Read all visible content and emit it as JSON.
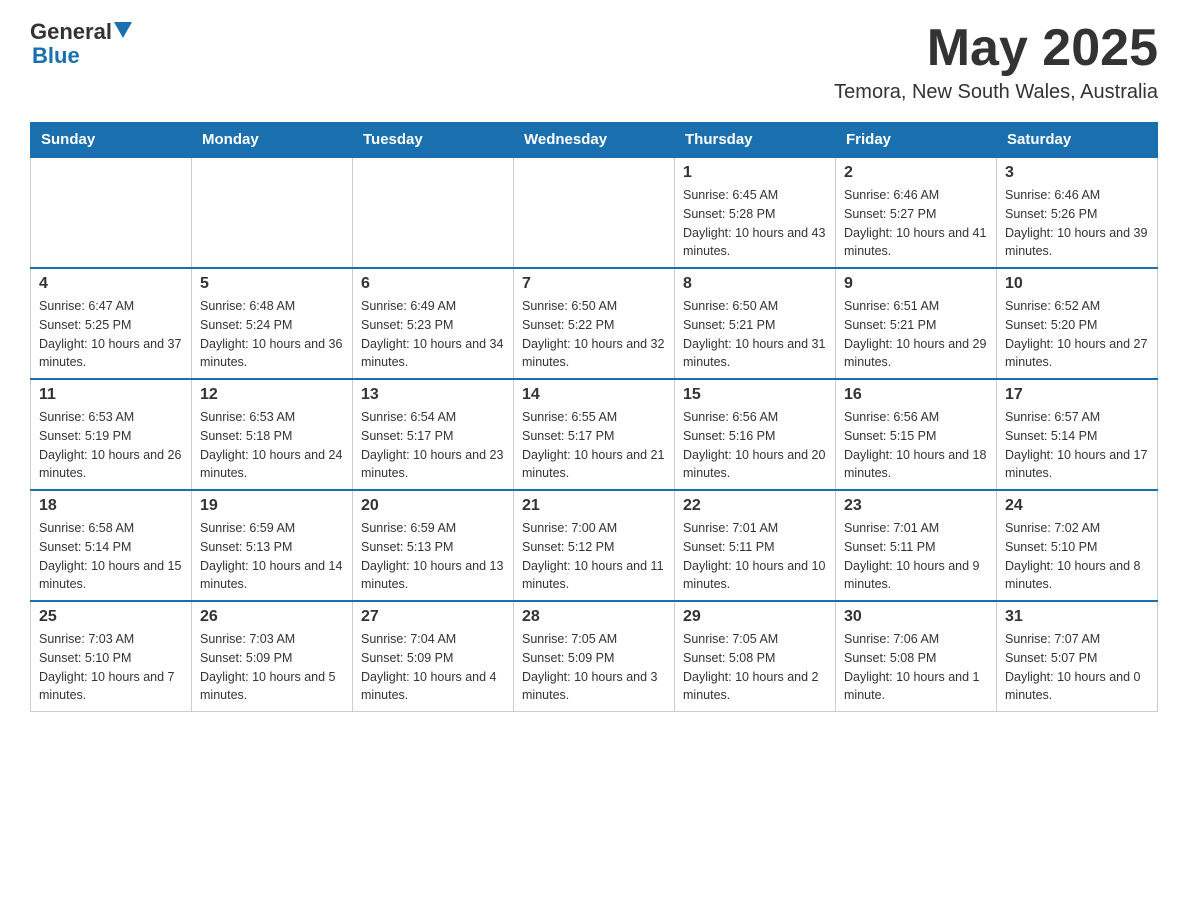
{
  "header": {
    "logo_general": "General",
    "logo_blue": "Blue",
    "month_title": "May 2025",
    "location": "Temora, New South Wales, Australia"
  },
  "days_of_week": [
    "Sunday",
    "Monday",
    "Tuesday",
    "Wednesday",
    "Thursday",
    "Friday",
    "Saturday"
  ],
  "weeks": [
    {
      "days": [
        {
          "num": "",
          "info": ""
        },
        {
          "num": "",
          "info": ""
        },
        {
          "num": "",
          "info": ""
        },
        {
          "num": "",
          "info": ""
        },
        {
          "num": "1",
          "info": "Sunrise: 6:45 AM\nSunset: 5:28 PM\nDaylight: 10 hours and 43 minutes."
        },
        {
          "num": "2",
          "info": "Sunrise: 6:46 AM\nSunset: 5:27 PM\nDaylight: 10 hours and 41 minutes."
        },
        {
          "num": "3",
          "info": "Sunrise: 6:46 AM\nSunset: 5:26 PM\nDaylight: 10 hours and 39 minutes."
        }
      ]
    },
    {
      "days": [
        {
          "num": "4",
          "info": "Sunrise: 6:47 AM\nSunset: 5:25 PM\nDaylight: 10 hours and 37 minutes."
        },
        {
          "num": "5",
          "info": "Sunrise: 6:48 AM\nSunset: 5:24 PM\nDaylight: 10 hours and 36 minutes."
        },
        {
          "num": "6",
          "info": "Sunrise: 6:49 AM\nSunset: 5:23 PM\nDaylight: 10 hours and 34 minutes."
        },
        {
          "num": "7",
          "info": "Sunrise: 6:50 AM\nSunset: 5:22 PM\nDaylight: 10 hours and 32 minutes."
        },
        {
          "num": "8",
          "info": "Sunrise: 6:50 AM\nSunset: 5:21 PM\nDaylight: 10 hours and 31 minutes."
        },
        {
          "num": "9",
          "info": "Sunrise: 6:51 AM\nSunset: 5:21 PM\nDaylight: 10 hours and 29 minutes."
        },
        {
          "num": "10",
          "info": "Sunrise: 6:52 AM\nSunset: 5:20 PM\nDaylight: 10 hours and 27 minutes."
        }
      ]
    },
    {
      "days": [
        {
          "num": "11",
          "info": "Sunrise: 6:53 AM\nSunset: 5:19 PM\nDaylight: 10 hours and 26 minutes."
        },
        {
          "num": "12",
          "info": "Sunrise: 6:53 AM\nSunset: 5:18 PM\nDaylight: 10 hours and 24 minutes."
        },
        {
          "num": "13",
          "info": "Sunrise: 6:54 AM\nSunset: 5:17 PM\nDaylight: 10 hours and 23 minutes."
        },
        {
          "num": "14",
          "info": "Sunrise: 6:55 AM\nSunset: 5:17 PM\nDaylight: 10 hours and 21 minutes."
        },
        {
          "num": "15",
          "info": "Sunrise: 6:56 AM\nSunset: 5:16 PM\nDaylight: 10 hours and 20 minutes."
        },
        {
          "num": "16",
          "info": "Sunrise: 6:56 AM\nSunset: 5:15 PM\nDaylight: 10 hours and 18 minutes."
        },
        {
          "num": "17",
          "info": "Sunrise: 6:57 AM\nSunset: 5:14 PM\nDaylight: 10 hours and 17 minutes."
        }
      ]
    },
    {
      "days": [
        {
          "num": "18",
          "info": "Sunrise: 6:58 AM\nSunset: 5:14 PM\nDaylight: 10 hours and 15 minutes."
        },
        {
          "num": "19",
          "info": "Sunrise: 6:59 AM\nSunset: 5:13 PM\nDaylight: 10 hours and 14 minutes."
        },
        {
          "num": "20",
          "info": "Sunrise: 6:59 AM\nSunset: 5:13 PM\nDaylight: 10 hours and 13 minutes."
        },
        {
          "num": "21",
          "info": "Sunrise: 7:00 AM\nSunset: 5:12 PM\nDaylight: 10 hours and 11 minutes."
        },
        {
          "num": "22",
          "info": "Sunrise: 7:01 AM\nSunset: 5:11 PM\nDaylight: 10 hours and 10 minutes."
        },
        {
          "num": "23",
          "info": "Sunrise: 7:01 AM\nSunset: 5:11 PM\nDaylight: 10 hours and 9 minutes."
        },
        {
          "num": "24",
          "info": "Sunrise: 7:02 AM\nSunset: 5:10 PM\nDaylight: 10 hours and 8 minutes."
        }
      ]
    },
    {
      "days": [
        {
          "num": "25",
          "info": "Sunrise: 7:03 AM\nSunset: 5:10 PM\nDaylight: 10 hours and 7 minutes."
        },
        {
          "num": "26",
          "info": "Sunrise: 7:03 AM\nSunset: 5:09 PM\nDaylight: 10 hours and 5 minutes."
        },
        {
          "num": "27",
          "info": "Sunrise: 7:04 AM\nSunset: 5:09 PM\nDaylight: 10 hours and 4 minutes."
        },
        {
          "num": "28",
          "info": "Sunrise: 7:05 AM\nSunset: 5:09 PM\nDaylight: 10 hours and 3 minutes."
        },
        {
          "num": "29",
          "info": "Sunrise: 7:05 AM\nSunset: 5:08 PM\nDaylight: 10 hours and 2 minutes."
        },
        {
          "num": "30",
          "info": "Sunrise: 7:06 AM\nSunset: 5:08 PM\nDaylight: 10 hours and 1 minute."
        },
        {
          "num": "31",
          "info": "Sunrise: 7:07 AM\nSunset: 5:07 PM\nDaylight: 10 hours and 0 minutes."
        }
      ]
    }
  ]
}
